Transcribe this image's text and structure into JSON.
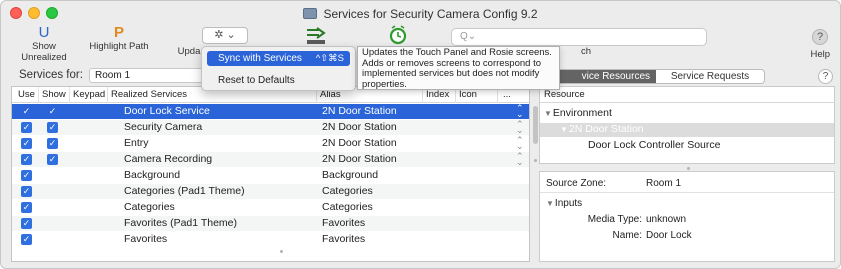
{
  "window": {
    "title": "Services for Security Camera Config 9.2"
  },
  "toolbar": {
    "show_unrealized": {
      "glyph": "U",
      "label": "Show Unrealized"
    },
    "highlight_path": {
      "glyph": "P",
      "label": "Highlight Path"
    },
    "update_label_partial": "Upda",
    "search_label_partial": "ch",
    "gear_glyph": "✲ ⌄",
    "search_placeholder": "Q⌄",
    "help_glyph": "?",
    "help_label": "Help"
  },
  "menu": {
    "items": [
      {
        "label": "Sync with Services",
        "shortcut": "^⇧⌘S",
        "selected": true
      },
      {
        "label": "Reset to Defaults",
        "shortcut": "",
        "selected": false
      }
    ]
  },
  "tooltip": {
    "text": "Updates the Touch Panel and Rosie screens. Adds or removes screens to correspond to implemented services but does not modify properties."
  },
  "left": {
    "services_for_label": "Services for:",
    "room_value": "Room 1",
    "columns": [
      "Use",
      "Show",
      "Keypad",
      "Realized Services",
      "Alias",
      "Index",
      "Icon",
      "..."
    ],
    "rows": [
      {
        "use": true,
        "show": true,
        "service": "Door Lock Service",
        "alias": "2N Door Station",
        "stepper": true,
        "selected": true
      },
      {
        "use": true,
        "show": true,
        "service": "Security Camera",
        "alias": "2N Door Station",
        "stepper": true,
        "selected": false
      },
      {
        "use": true,
        "show": true,
        "service": "Entry",
        "alias": "2N Door Station",
        "stepper": true,
        "selected": false
      },
      {
        "use": true,
        "show": true,
        "service": "Camera Recording",
        "alias": "2N Door Station",
        "stepper": true,
        "selected": false
      },
      {
        "use": true,
        "show": false,
        "service": "Background",
        "alias": "Background",
        "stepper": false,
        "selected": false
      },
      {
        "use": true,
        "show": false,
        "service": "Categories (Pad1 Theme)",
        "alias": "Categories",
        "stepper": false,
        "selected": false
      },
      {
        "use": true,
        "show": false,
        "service": "Categories",
        "alias": "Categories",
        "stepper": false,
        "selected": false
      },
      {
        "use": true,
        "show": false,
        "service": "Favorites (Pad1 Theme)",
        "alias": "Favorites",
        "stepper": false,
        "selected": false
      },
      {
        "use": true,
        "show": false,
        "service": "Favorites",
        "alias": "Favorites",
        "stepper": false,
        "selected": false
      }
    ]
  },
  "right": {
    "tabs": [
      {
        "label": "vice Resources",
        "active": true
      },
      {
        "label": "Service Requests",
        "active": false
      }
    ],
    "help_glyph": "?",
    "resource_header": "Resource",
    "tree": {
      "environment": "Environment",
      "station": "2N Door Station",
      "door_lock": "Door Lock Controller Source"
    },
    "source_zone_label": "Source Zone:",
    "source_zone_value": "Room 1",
    "inputs_label": "Inputs",
    "media_type_label": "Media Type:",
    "media_type_value": "unknown",
    "name_label": "Name:",
    "name_value": "Door Lock"
  },
  "colors": {
    "selection": "#2a64d8",
    "checkbox": "#2f6fe0",
    "segment_active": "#646464",
    "toolbar_u": "#2e66c9",
    "toolbar_p": "#e08a1e"
  }
}
